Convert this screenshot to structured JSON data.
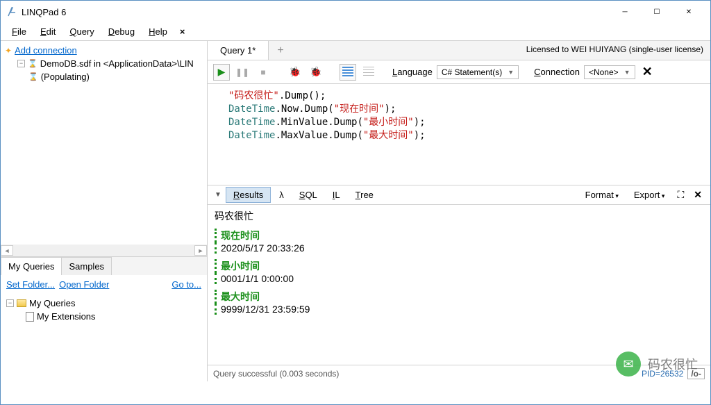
{
  "window": {
    "title": "LINQPad 6"
  },
  "menu": {
    "file": "File",
    "edit": "Edit",
    "query": "Query",
    "debug": "Debug",
    "help": "Help"
  },
  "sidebar": {
    "add_connection": "Add connection",
    "db_line": "DemoDB.sdf in <ApplicationData>\\LIN",
    "populating": "(Populating)",
    "tabs": {
      "myqueries": "My Queries",
      "samples": "Samples"
    },
    "footer": {
      "setfolder": "Set Folder...",
      "openfolder": "Open Folder",
      "goto": "Go to..."
    },
    "tree": {
      "myqueries": "My Queries",
      "myext": "My Extensions"
    }
  },
  "editor": {
    "tab": "Query 1*",
    "license": "Licensed to WEI HUIYANG (single-user license)",
    "lang_label": "Language",
    "lang_value": "C# Statement(s)",
    "conn_label": "Connection",
    "conn_value": "<None>",
    "code": {
      "l1_str": "\"码农很忙\"",
      "l1_rest": ".Dump();",
      "l2_typ": "DateTime",
      "l2_mid": ".Now.Dump(",
      "l2_str": "\"现在时间\"",
      "l2_end": ");",
      "l3_typ": "DateTime",
      "l3_mid": ".MinValue.Dump(",
      "l3_str": "\"最小时间\"",
      "l3_end": ");",
      "l4_typ": "DateTime",
      "l4_mid": ".MaxValue.Dump(",
      "l4_str": "\"最大时间\"",
      "l4_end": ");"
    }
  },
  "results_tabs": {
    "results": "Results",
    "lambda": "λ",
    "sql": "SQL",
    "il": "IL",
    "tree": "Tree",
    "format": "Format",
    "export": "Export"
  },
  "results": {
    "first": "码农很忙",
    "h1": "现在时间",
    "v1": "2020/5/17 20:33:26",
    "h2": "最小时间",
    "v2": "0001/1/1 0:00:00",
    "h3": "最大时间",
    "v3": "9999/12/31 23:59:59"
  },
  "status": {
    "msg": "Query successful  (0.003 seconds)",
    "pid": "PID=26532",
    "slash": "/o-"
  },
  "watermark": "码农很忙"
}
